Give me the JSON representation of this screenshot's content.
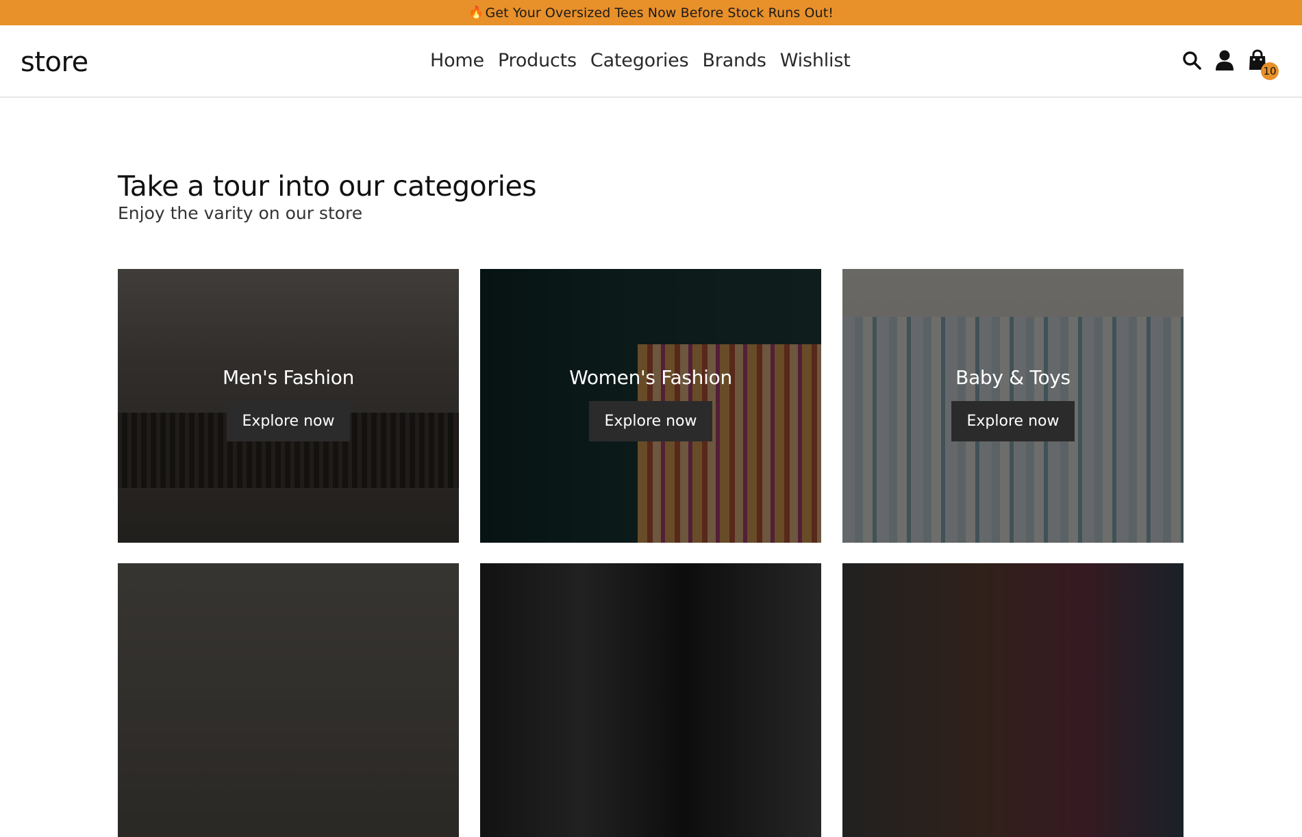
{
  "promo": {
    "icon": "flame-icon",
    "text": "Get Your Oversized Tees Now Before Stock Runs Out!",
    "color": "#e8902a"
  },
  "header": {
    "logo": "store",
    "nav": [
      "Home",
      "Products",
      "Categories",
      "Brands",
      "Wishlist"
    ],
    "cart_count": "10"
  },
  "section": {
    "title": "Take a tour into our categories",
    "subtitle": "Enjoy the varity on our store"
  },
  "categories": [
    {
      "title": "Men's Fashion",
      "button": "Explore now"
    },
    {
      "title": "Women's Fashion",
      "button": "Explore now"
    },
    {
      "title": "Baby & Toys",
      "button": "Explore now"
    }
  ]
}
